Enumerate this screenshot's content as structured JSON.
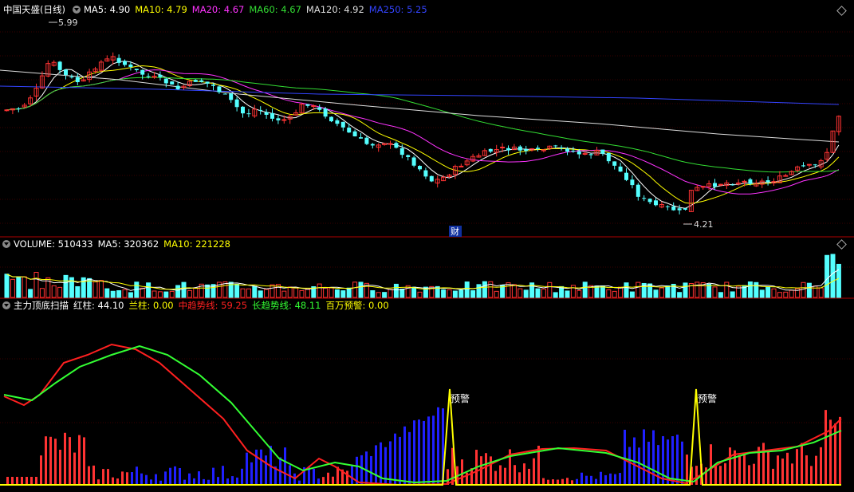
{
  "price_panel": {
    "stock_name": "中国天盛(日线)",
    "ma_items": [
      {
        "label": "MA5: 4.90",
        "color": "#ffffff"
      },
      {
        "label": "MA10: 4.79",
        "color": "#ffff00"
      },
      {
        "label": "MA20: 4.67",
        "color": "#ff33ff"
      },
      {
        "label": "MA60: 4.67",
        "color": "#33dd33"
      },
      {
        "label": "MA120: 4.92",
        "color": "#dddddd"
      },
      {
        "label": "MA250: 5.25",
        "color": "#3344ff"
      }
    ],
    "high_label": "5.99",
    "low_label": "4.21",
    "finance_marker": "财"
  },
  "volume_panel": {
    "title": "VOLUME: 510433",
    "ma_items": [
      {
        "label": "MA5: 320362",
        "color": "#ffffff"
      },
      {
        "label": "MA10: 221228",
        "color": "#ffff00"
      }
    ]
  },
  "indicator_panel": {
    "title": "主力顶底扫描",
    "items": [
      {
        "label": "红柱: 44.10",
        "color": "#ffffff"
      },
      {
        "label": "兰柱: 0.00",
        "color": "#ffff00"
      },
      {
        "label": "中趋势线: 59.25",
        "color": "#ff2020"
      },
      {
        "label": "长趋势线: 48.11",
        "color": "#33ff33"
      },
      {
        "label": "百万预警: 0.00",
        "color": "#ffff00"
      }
    ],
    "alert_label": "预警"
  },
  "colors": {
    "up": "#ff3333",
    "down": "#54ffff",
    "panel_border": "#b00000",
    "blue_bar": "#2020ff"
  },
  "chart_data": [
    {
      "type": "candlestick",
      "title": "中国天盛(日线)",
      "ylim": [
        4.0,
        6.2
      ],
      "x_count": 140,
      "annotations": [
        {
          "text": "5.99",
          "y": 5.99
        },
        {
          "text": "4.21",
          "y": 4.21
        }
      ],
      "series": [
        {
          "name": "MA5",
          "value": 4.9
        },
        {
          "name": "MA10",
          "value": 4.79
        },
        {
          "name": "MA20",
          "value": 4.67
        },
        {
          "name": "MA60",
          "value": 4.67
        },
        {
          "name": "MA120",
          "value": 4.92
        },
        {
          "name": "MA250",
          "value": 5.25
        }
      ]
    },
    {
      "type": "bar",
      "title": "VOLUME",
      "last_value": 510433,
      "series": [
        {
          "name": "MA5",
          "value": 320362
        },
        {
          "name": "MA10",
          "value": 221228
        }
      ]
    },
    {
      "type": "line",
      "title": "主力顶底扫描",
      "ylim": [
        0,
        100
      ],
      "series": [
        {
          "name": "红柱",
          "value": 44.1
        },
        {
          "name": "兰柱",
          "value": 0.0
        },
        {
          "name": "中趋势线",
          "value": 59.25
        },
        {
          "name": "长趋势线",
          "value": 48.11
        },
        {
          "name": "百万预警",
          "value": 0.0
        }
      ]
    }
  ]
}
